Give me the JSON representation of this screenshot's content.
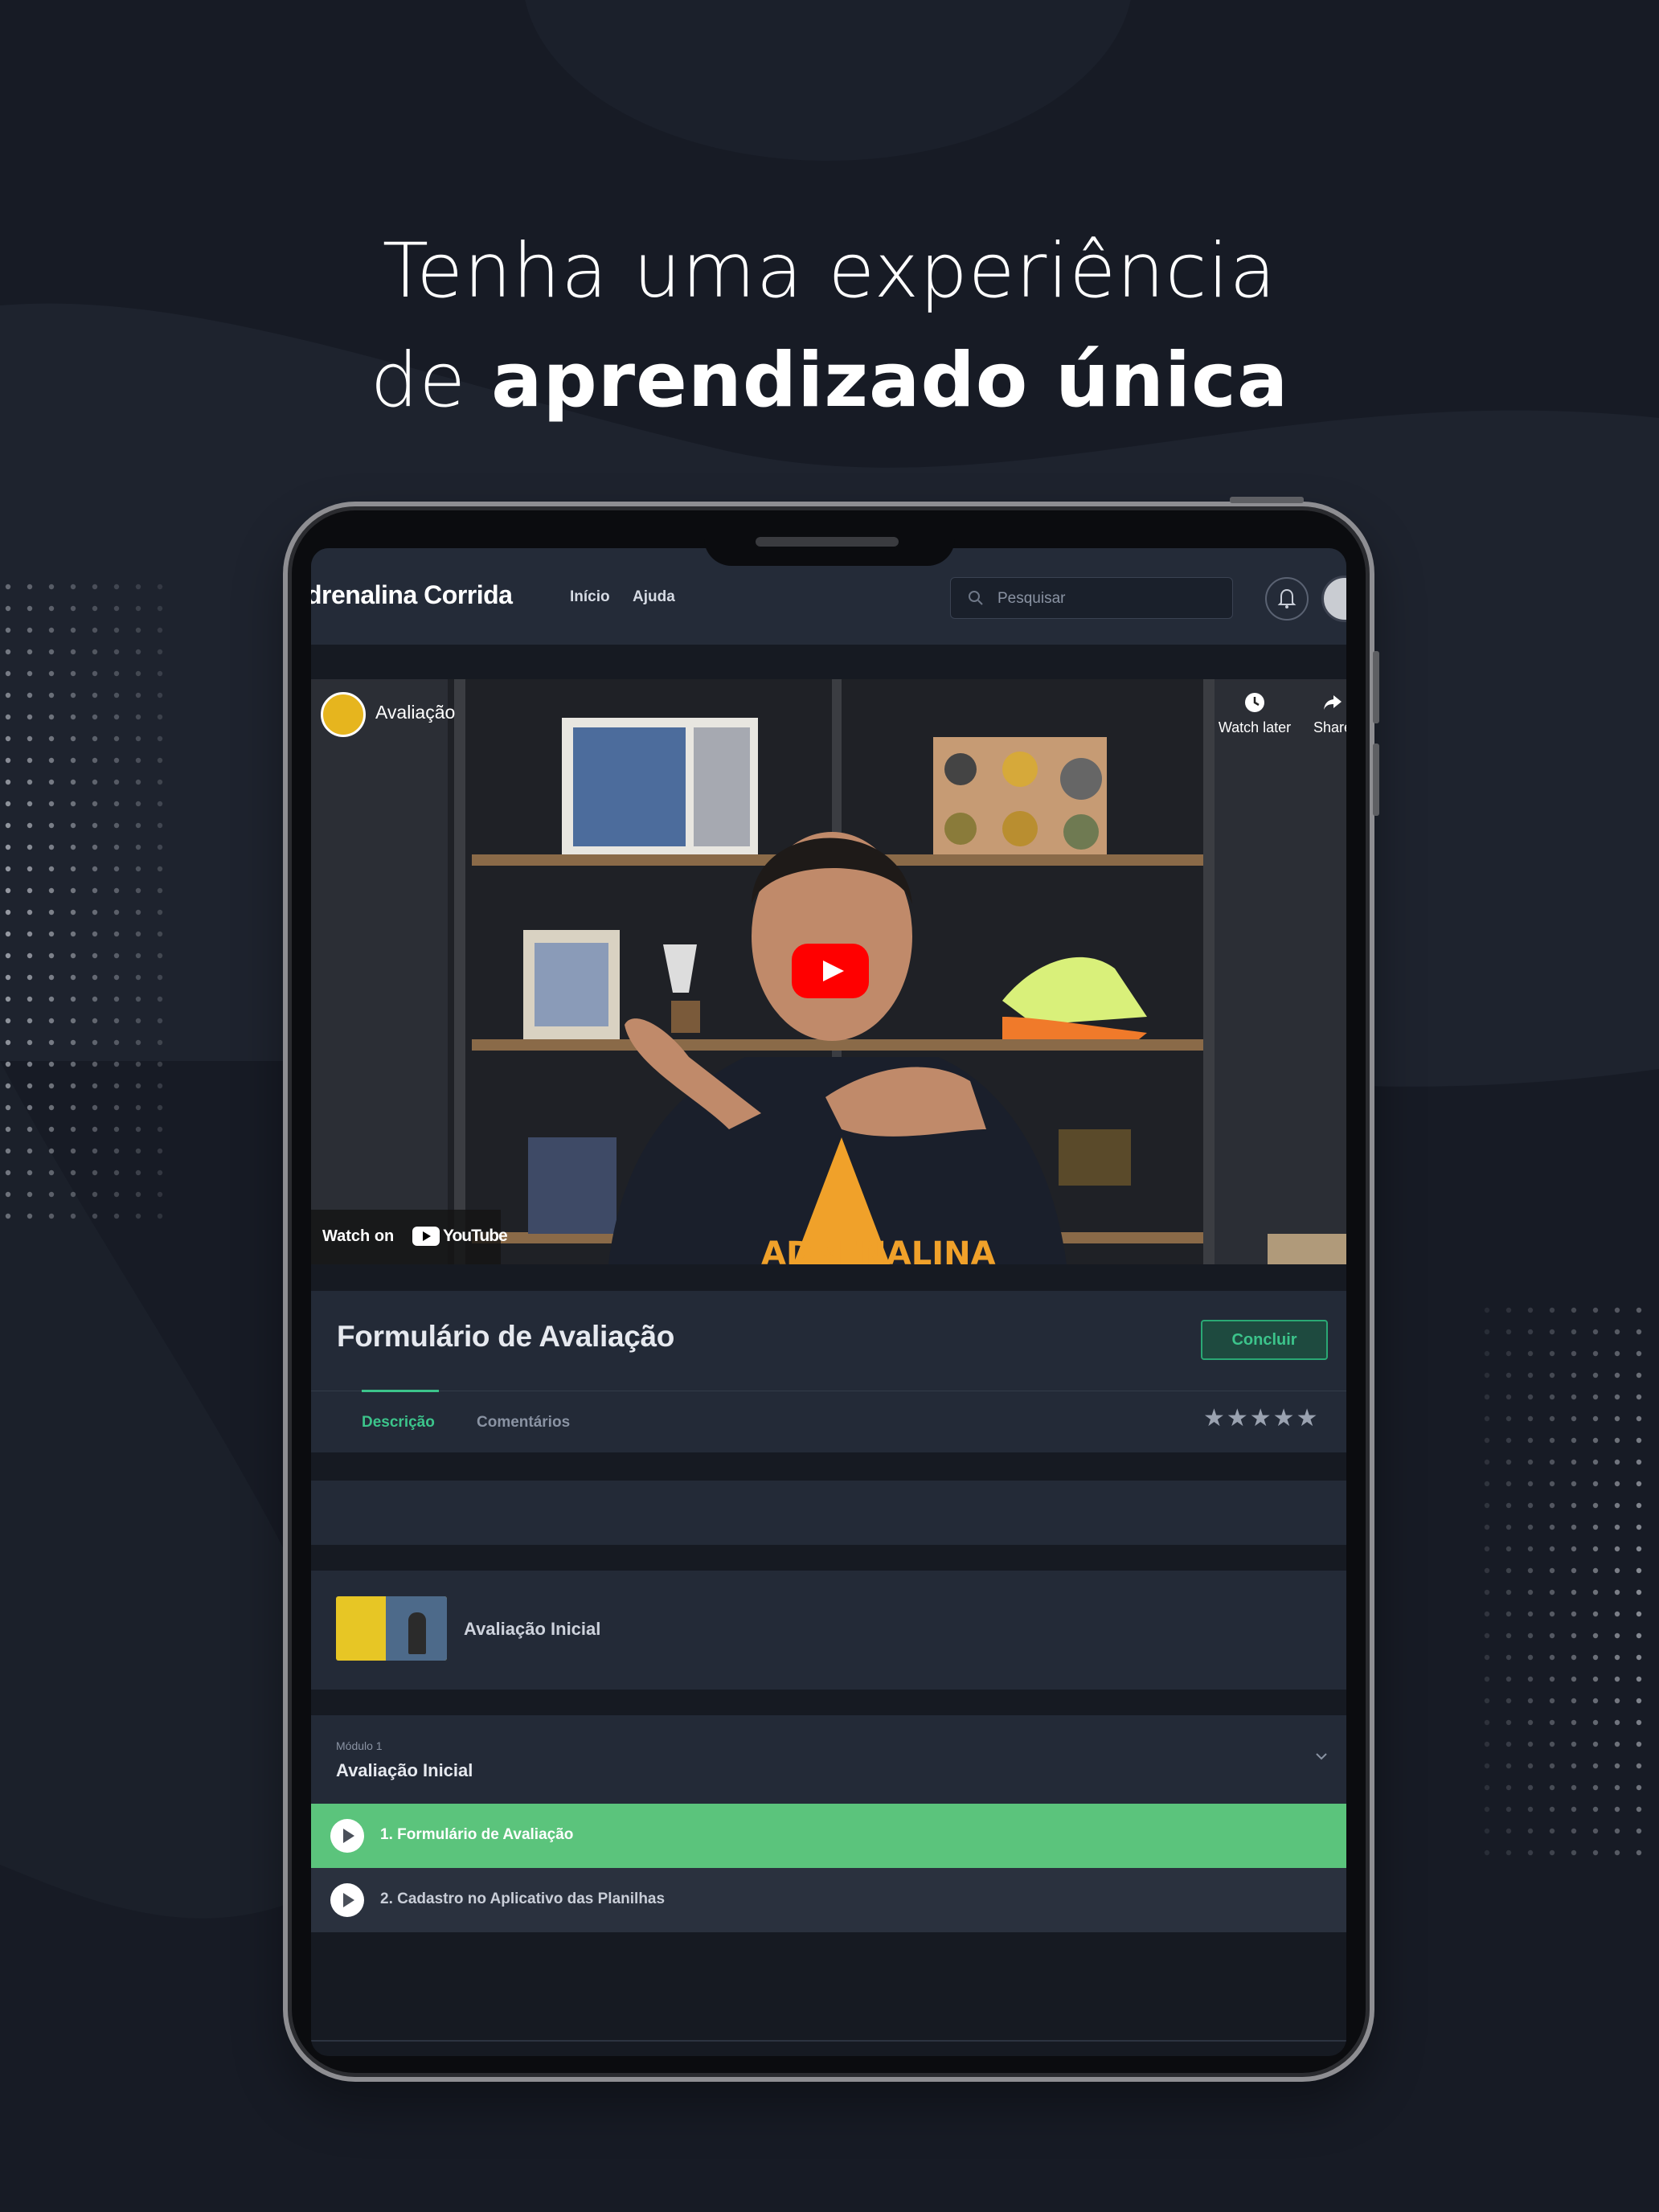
{
  "headline": {
    "line1": "Tenha uma experiência",
    "line2_prefix": "de ",
    "line2_bold": "aprendizado única"
  },
  "navbar": {
    "brand": "drenalina Corrida",
    "links": [
      "Início",
      "Ajuda"
    ],
    "search_placeholder": "Pesquisar"
  },
  "video": {
    "title": "Avaliação",
    "watch_later": "Watch later",
    "share": "Share",
    "watch_on": "Watch on",
    "youtube_label": "YouTube",
    "play_icon": "youtube-play-icon"
  },
  "lesson": {
    "title": "Formulário de Avaliação",
    "complete_button": "Concluir",
    "tabs": [
      "Descrição",
      "Comentários"
    ],
    "rating_stars": "★★★★★"
  },
  "course": {
    "name": "Avaliação Inicial"
  },
  "module": {
    "label": "Módulo 1",
    "name": "Avaliação Inicial",
    "items": [
      {
        "label": "1. Formulário de Avaliação",
        "active": true
      },
      {
        "label": "2. Cadastro no Aplicativo das Planilhas",
        "active": false
      }
    ]
  },
  "colors": {
    "background": "#171b25",
    "accent_green": "#5bc47c",
    "panel": "#232a37",
    "youtube_red": "#ff0000"
  }
}
